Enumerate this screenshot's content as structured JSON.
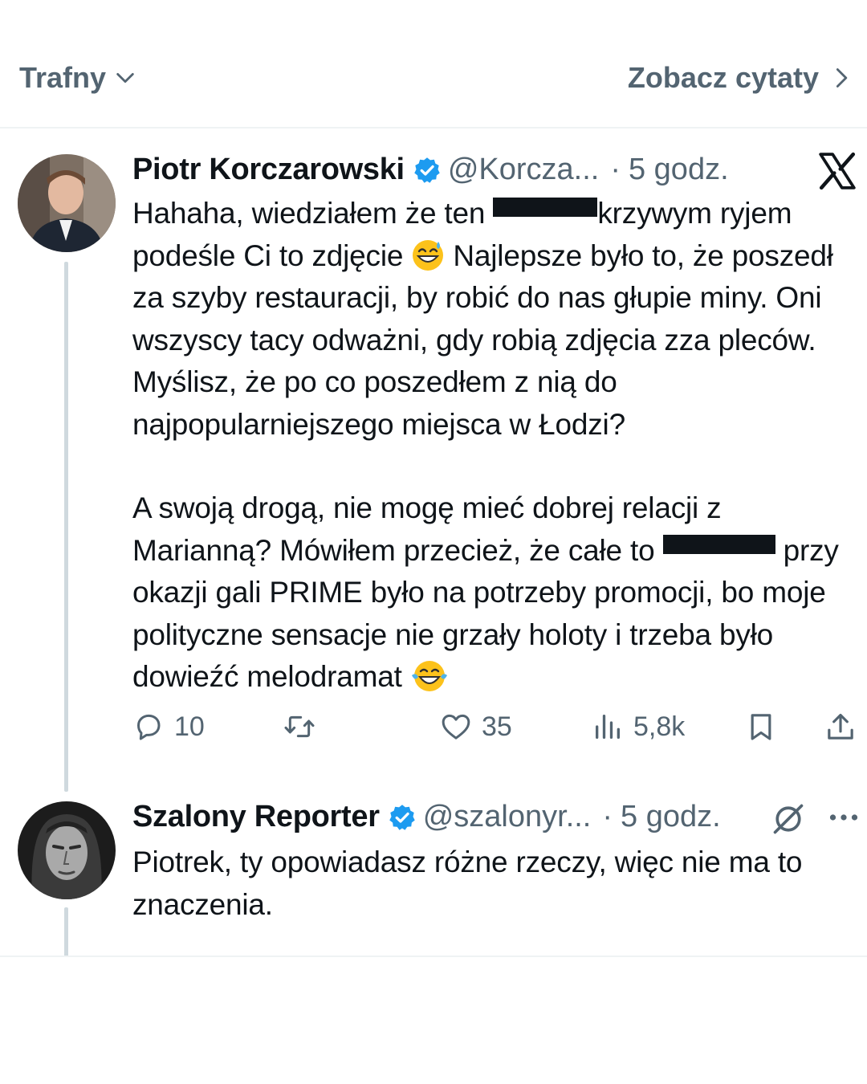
{
  "top_bar": {
    "sort_label": "Trafny",
    "quotes_label": "Zobacz cytaty"
  },
  "tweets": [
    {
      "name": "Piotr Korczarowski",
      "handle": "@Korcza...",
      "separator": "·",
      "time": "5 godz.",
      "paragraph1_part1": "Hahaha, wiedziałem że ten ",
      "paragraph1_part2": "krzywym ryjem podeśle Ci to zdjęcie ",
      "paragraph1_part3": " Najlepsze było to, że poszedł za szyby restauracji, by robić do nas głupie miny. Oni wszyscy tacy odważni, gdy robią zdjęcia zza pleców. Myślisz, że po co poszedłem z nią do najpopularniejszego miejsca w Łodzi?",
      "paragraph2_part1": "A swoją drogą, nie mogę mieć dobrej relacji z Marianną? Mówiłem przecież, że całe to ",
      "paragraph2_part2": " przy okazji gali PRIME było na potrzeby promocji, bo moje polityczne sensacje nie grzały holoty i trzeba było dowieźć melodramat ",
      "stats": {
        "replies": "10",
        "retweets": "",
        "likes": "35",
        "views": "5,8k"
      }
    },
    {
      "name": "Szalony Reporter",
      "handle": "@szalonyr...",
      "separator": "·",
      "time": "5 godz.",
      "text": "Piotrek, ty opowiadasz różne rzeczy, więc nie ma to znaczenia."
    }
  ],
  "icons": {
    "verified": "verified-badge-icon",
    "platform": "x-logo-icon",
    "reply": "reply-bubble-icon",
    "retweet": "retweet-icon",
    "like": "heart-icon",
    "views": "views-bars-icon",
    "bookmark": "bookmark-icon",
    "share": "share-icon",
    "grok": "grok-icon",
    "more": "more-dots-icon"
  },
  "colors": {
    "text": "#0f1419",
    "secondary": "#536471",
    "verified": "#1d9bf0",
    "divider": "#eff3f4",
    "thread_line": "#cfd9de"
  }
}
